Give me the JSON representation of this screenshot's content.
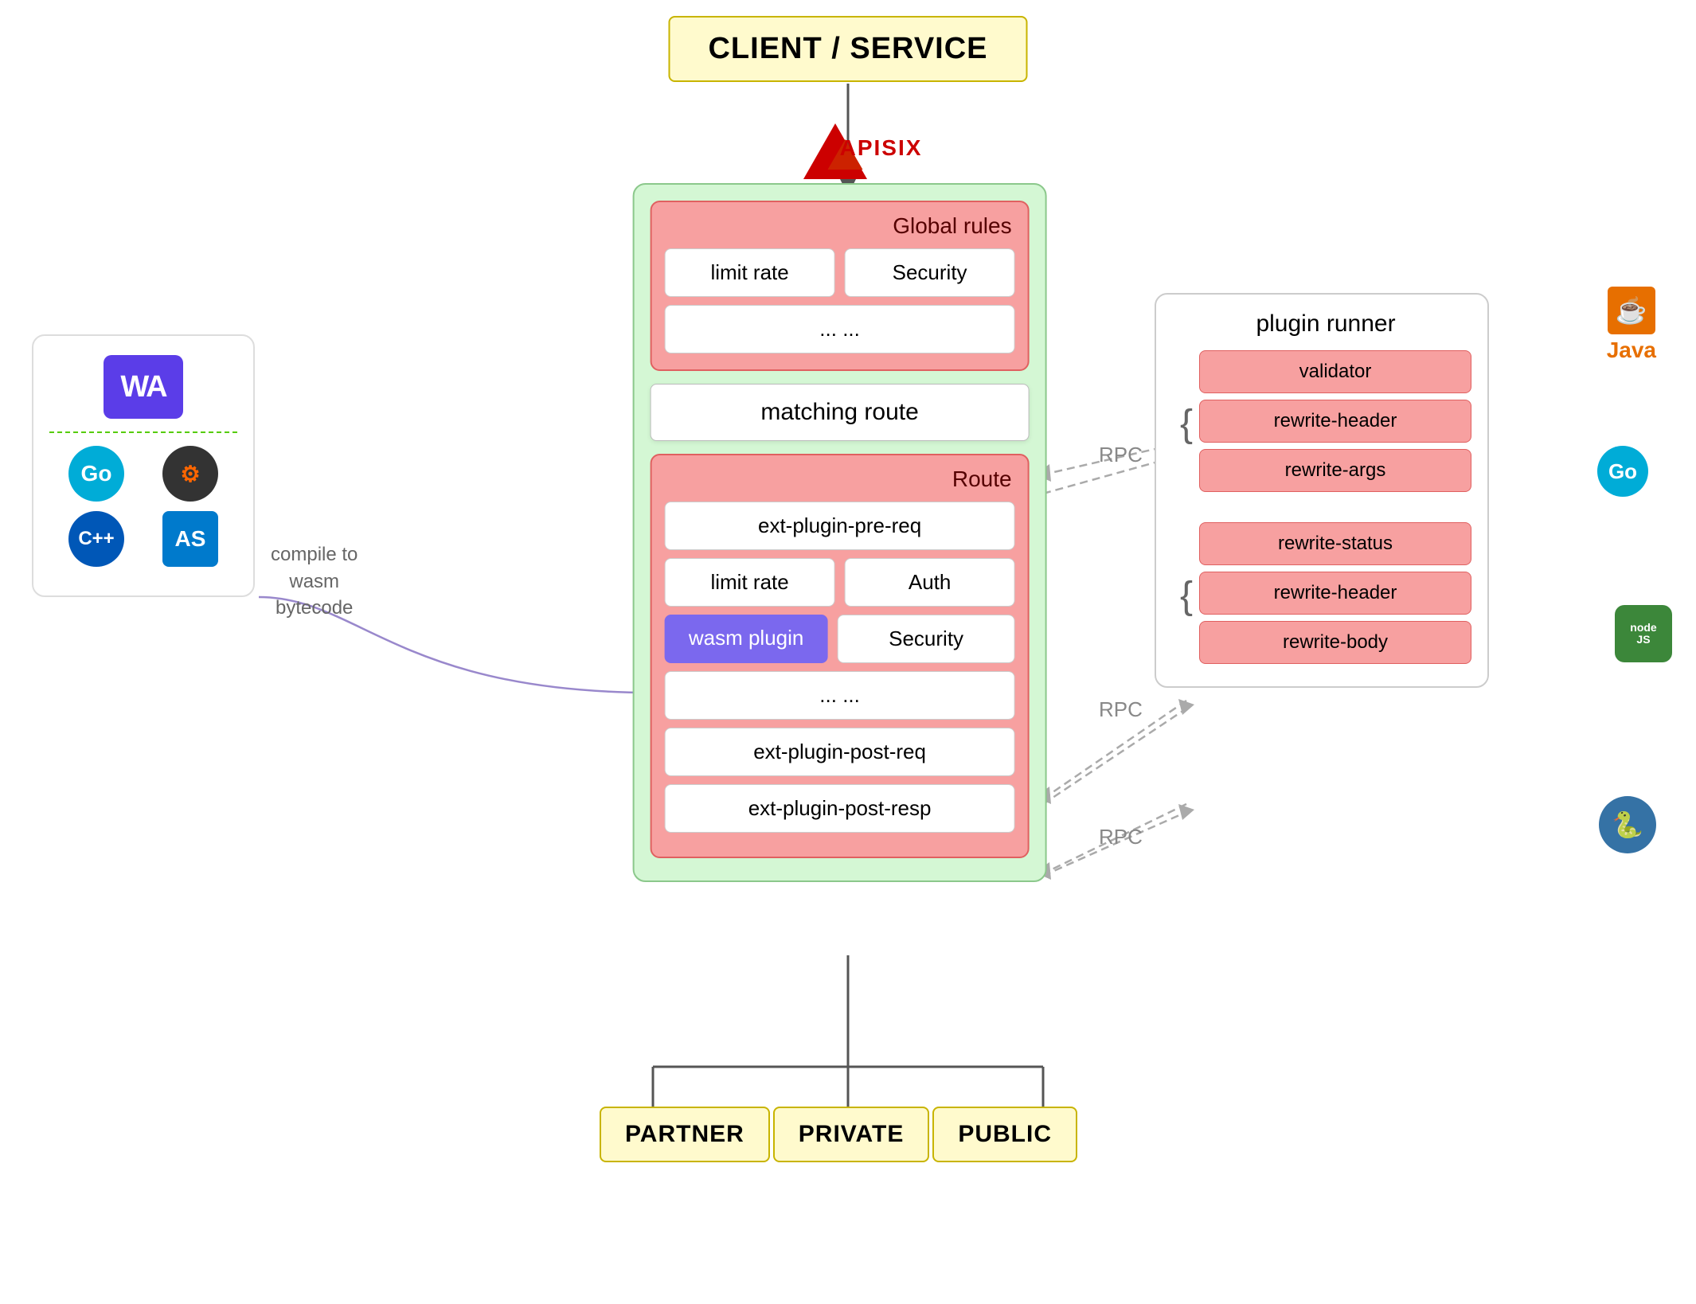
{
  "header": {
    "client_service": "CLIENT / SERVICE"
  },
  "apisix": {
    "logo_text": "APISIX"
  },
  "global_rules": {
    "title": "Global rules",
    "plugins": [
      "limit rate",
      "Security"
    ],
    "ellipsis": "... ..."
  },
  "matching_route": {
    "label": "matching route"
  },
  "route": {
    "title": "Route",
    "plugins": [
      "ext-plugin-pre-req",
      "limit rate",
      "Auth",
      "wasm plugin",
      "Security",
      "... ...",
      "ext-plugin-post-req",
      "ext-plugin-post-resp"
    ]
  },
  "plugin_runner": {
    "title": "plugin runner",
    "group1": [
      "validator",
      "rewrite-header",
      "rewrite-args"
    ],
    "group2": [
      "rewrite-status",
      "rewrite-header",
      "rewrite-body"
    ],
    "rpc_labels": [
      "RPC",
      "RPC",
      "RPC"
    ]
  },
  "left_panel": {
    "wa_label": "WA",
    "compile_label": "compile to\nwasm\nbytecode",
    "icons": [
      "Go",
      "Rust",
      "C++",
      "AS"
    ]
  },
  "destinations": [
    {
      "label": "PARTNER"
    },
    {
      "label": "PRIVATE"
    },
    {
      "label": "PUBLIC"
    }
  ],
  "languages": [
    {
      "name": "Java",
      "color": "#e76f00"
    },
    {
      "name": "Go",
      "color": "#00acd7"
    },
    {
      "name": "node\nJS",
      "color": "#3c873a"
    },
    {
      "name": "Python",
      "color": "#3572a5"
    }
  ]
}
